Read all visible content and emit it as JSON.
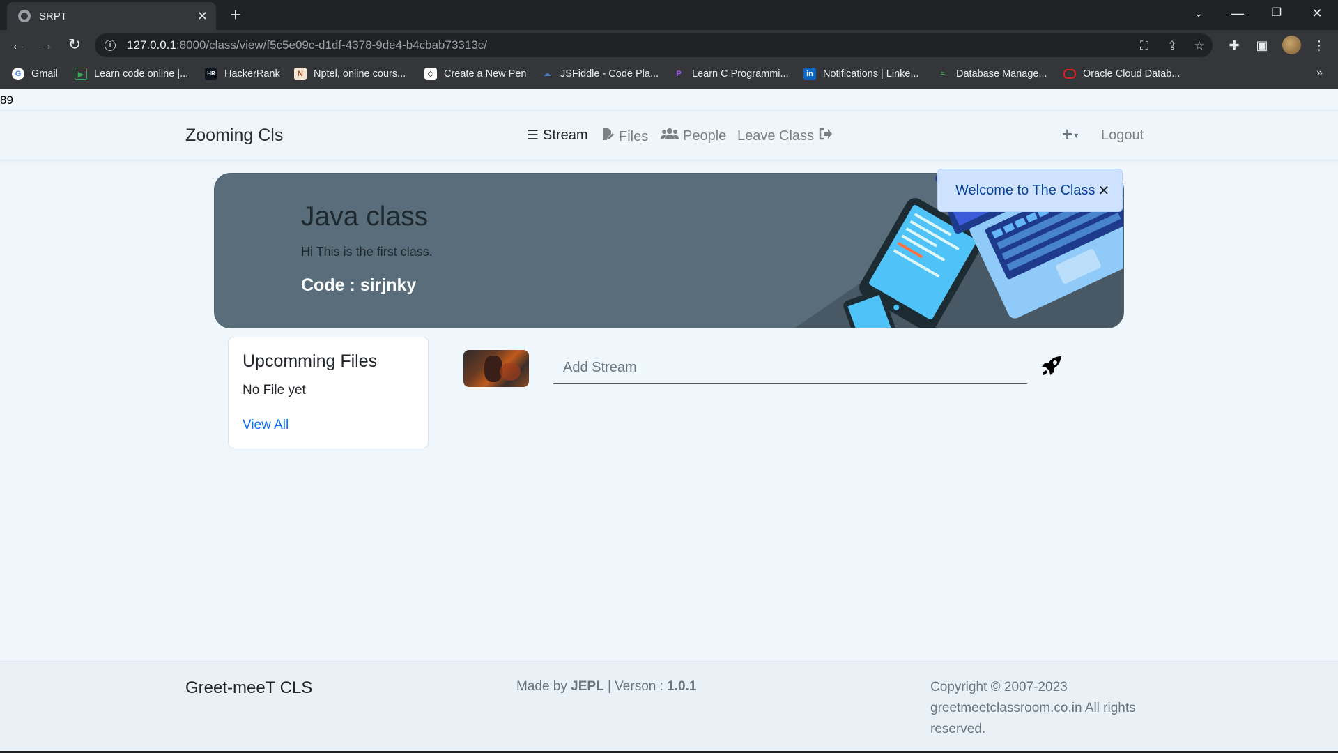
{
  "browser": {
    "tab_title": "SRPT",
    "url_host": "127.0.0.1",
    "url_path": ":8000/class/view/f5c5e09c-d1df-4378-9de4-b4cbab73313c/",
    "bookmarks": [
      {
        "label": "Gmail",
        "icon": "google-icon"
      },
      {
        "label": "Learn code online |...",
        "icon": "code-icon"
      },
      {
        "label": "HackerRank",
        "icon": "hackerrank-icon"
      },
      {
        "label": "Nptel, online cours...",
        "icon": "nptel-icon"
      },
      {
        "label": "Create a New Pen",
        "icon": "codepen-icon"
      },
      {
        "label": "JSFiddle - Code Pla...",
        "icon": "jsfiddle-icon"
      },
      {
        "label": "Learn C Programmi...",
        "icon": "c-icon"
      },
      {
        "label": "Notifications | Linke...",
        "icon": "linkedin-icon"
      },
      {
        "label": "Database Manage...",
        "icon": "database-icon"
      },
      {
        "label": "Oracle Cloud Datab...",
        "icon": "oracle-icon"
      }
    ]
  },
  "page": {
    "counter": "89"
  },
  "navbar": {
    "brand": "Zooming Cls",
    "items": [
      {
        "label": "Stream",
        "icon": "bars-icon"
      },
      {
        "label": "Files",
        "icon": "file-edit-icon"
      },
      {
        "label": "People",
        "icon": "users-icon"
      },
      {
        "label": "Leave Class",
        "icon": "sign-out-icon"
      }
    ],
    "plus_label": "+",
    "logout": "Logout"
  },
  "banner": {
    "title": "Java class",
    "description": "Hi This is the first class.",
    "code": "Code : sirjnky"
  },
  "toast": {
    "message": "Welcome to The Class"
  },
  "files_card": {
    "title": "Upcomming Files",
    "empty_text": "No File yet",
    "link_label": "View All"
  },
  "stream": {
    "placeholder": "Add Stream"
  },
  "footer": {
    "brand": "Greet-meeT CLS",
    "made_prefix": "Made by ",
    "made_author": "JEPL",
    "made_sep": " | Verson : ",
    "version": "1.0.1",
    "copyright": "Copyright © 2007-2023 greetmeetclassroom.co.in All rights reserved."
  },
  "colors": {
    "page_bg": "#eff7fd",
    "banner_bg": "#596d7a",
    "toast_bg": "#cfe2ff",
    "link": "#0d6efd"
  }
}
